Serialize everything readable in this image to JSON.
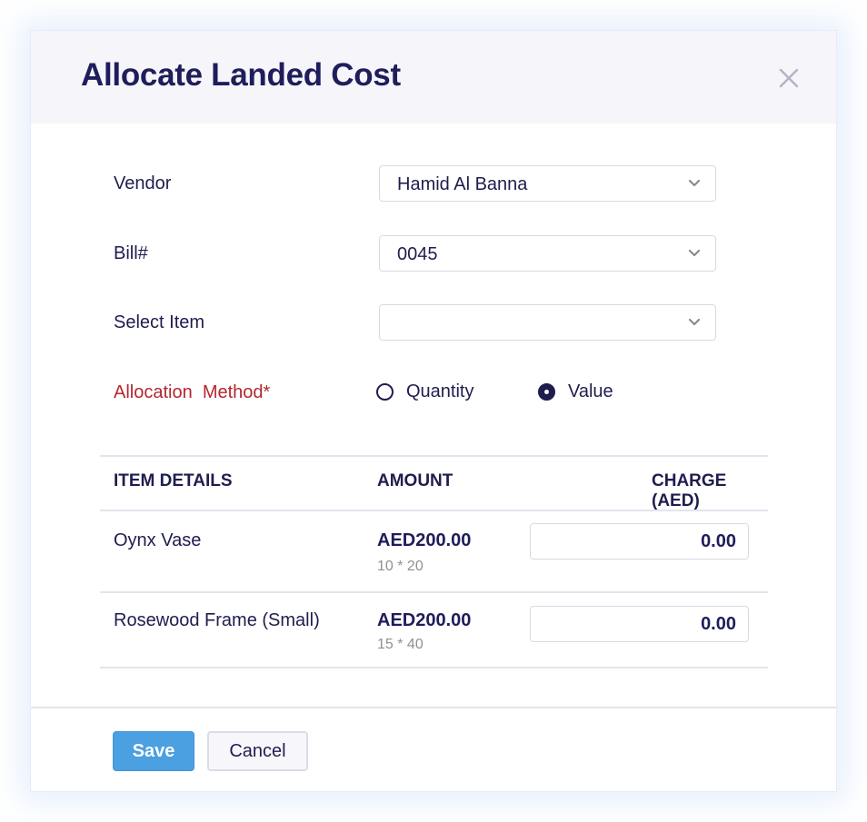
{
  "dialog": {
    "title": "Allocate Landed Cost",
    "close_icon": "close-icon"
  },
  "form": {
    "vendor": {
      "label": "Vendor",
      "value": "Hamid Al Banna",
      "icon": "chevron-down-icon"
    },
    "bill": {
      "label": "Bill#",
      "value": "0045",
      "icon": "chevron-down-icon"
    },
    "select_item": {
      "label": "Select Item",
      "value": "",
      "icon": "chevron-down-icon"
    },
    "allocation_method": {
      "label": "Allocation  Method*",
      "options": [
        {
          "label": "Quantity",
          "checked": false
        },
        {
          "label": "Value",
          "checked": true
        }
      ],
      "selected": "Value"
    }
  },
  "table": {
    "headers": {
      "item_details": "ITEM DETAILS",
      "amount": "AMOUNT",
      "charge": "CHARGE (AED)"
    },
    "rows": [
      {
        "item": "Oynx Vase",
        "amount": "AED200.00",
        "calc": "10 * 20",
        "charge": "0.00"
      },
      {
        "item": "Rosewood Frame (Small)",
        "amount": "AED200.00",
        "calc": "15 * 40",
        "charge": "0.00"
      }
    ]
  },
  "footer": {
    "save_label": "Save",
    "cancel_label": "Cancel"
  },
  "colors": {
    "title": "#1f1d5b",
    "text": "#1f1d4e",
    "required_label": "#b3282e",
    "primary_button": "#4aa0e0",
    "header_bg": "#f5f5fa",
    "muted_text": "#8f8f98"
  }
}
